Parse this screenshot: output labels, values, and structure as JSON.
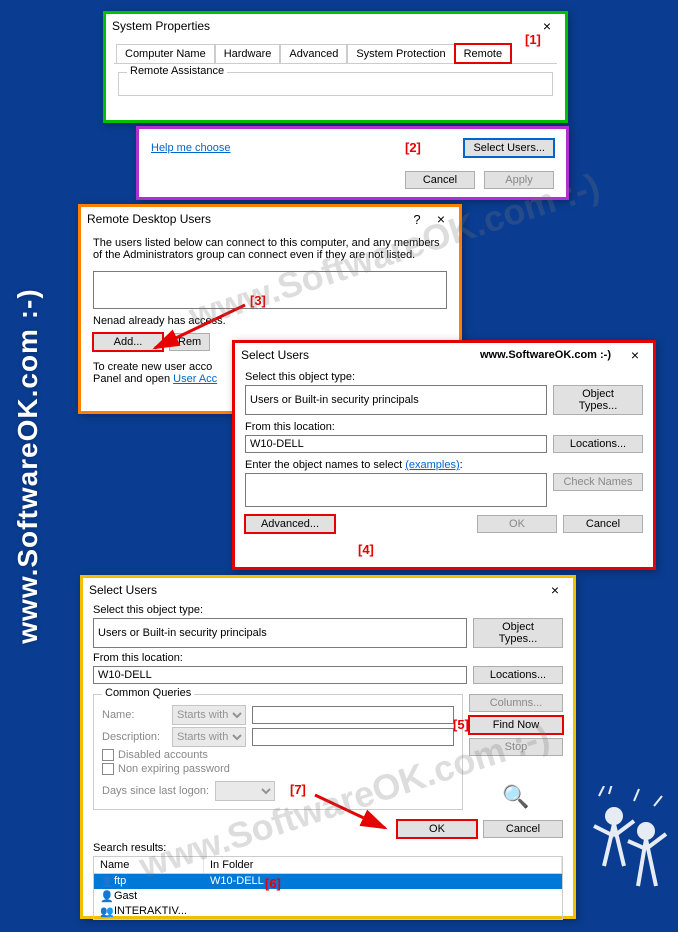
{
  "side_watermark": "www.SoftwareOK.com :-)",
  "diag_watermark_1": "www.SoftwareOK.com :-)",
  "diag_watermark_2": "www.SoftwareOK.com :-)",
  "markers": {
    "m1": "[1]",
    "m2": "[2]",
    "m3": "[3]",
    "m4": "[4]",
    "m5": "[5]",
    "m6": "[6]",
    "m7": "[7]"
  },
  "sysprops": {
    "title": "System Properties",
    "tabs": [
      "Computer Name",
      "Hardware",
      "Advanced",
      "System Protection",
      "Remote"
    ],
    "group": "Remote Assistance"
  },
  "helpbar": {
    "link": "Help me choose",
    "select_users": "Select Users...",
    "cancel": "Cancel",
    "apply": "Apply"
  },
  "rdu": {
    "title": "Remote Desktop Users",
    "desc": "The users listed below can connect to this computer, and any members of the Administrators group can connect even if they are not listed.",
    "access_note": "Nenad already has access.",
    "add": "Add...",
    "remove": "Rem",
    "create_note_1": "To create new user acco",
    "create_note_2": "Panel and open ",
    "user_acc_link": "User Acc"
  },
  "selectusers": {
    "title": "Select Users",
    "watermark": "www.SoftwareOK.com :-)",
    "obj_type_label": "Select this object type:",
    "obj_type_value": "Users or Built-in security principals",
    "object_types_btn": "Object Types...",
    "from_location_label": "From this location:",
    "from_location_value": "W10-DELL",
    "locations_btn": "Locations...",
    "enter_names_label": "Enter the object names to select ",
    "examples_link": "(examples)",
    "check_names": "Check Names",
    "advanced": "Advanced...",
    "ok": "OK",
    "cancel": "Cancel"
  },
  "selectusers_adv": {
    "title": "Select Users",
    "obj_type_label": "Select this object type:",
    "obj_type_value": "Users or Built-in security principals",
    "object_types_btn": "Object Types...",
    "from_location_label": "From this location:",
    "from_location_value": "W10-DELL",
    "locations_btn": "Locations...",
    "common_queries": "Common Queries",
    "name_label": "Name:",
    "starts_with": "Starts with",
    "desc_label": "Description:",
    "disabled_accounts": "Disabled accounts",
    "non_expiring": "Non expiring password",
    "days_since": "Days since last logon:",
    "columns": "Columns...",
    "find_now": "Find Now",
    "stop": "Stop",
    "ok": "OK",
    "cancel": "Cancel",
    "search_results": "Search results:",
    "col_name": "Name",
    "col_folder": "In Folder",
    "rows": [
      {
        "name": "ftp",
        "folder": "W10-DELL"
      },
      {
        "name": "Gast",
        "folder": ""
      },
      {
        "name": "INTERAKTIV...",
        "folder": ""
      }
    ]
  }
}
